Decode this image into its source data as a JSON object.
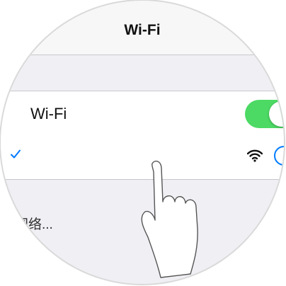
{
  "navbar": {
    "title": "Wi-Fi"
  },
  "wifi_row": {
    "label": "Wi-Fi",
    "toggle_state": "on",
    "toggle_color": "#4cd964"
  },
  "network_row": {
    "selected": true,
    "check_color": "#007aff",
    "signal_icon": "wifi-signal-icon",
    "info_icon": "info-icon"
  },
  "other_networks": {
    "label": "网络..."
  },
  "colors": {
    "accent": "#007aff",
    "background": "#efeff4",
    "separator": "#c8c7cc"
  }
}
